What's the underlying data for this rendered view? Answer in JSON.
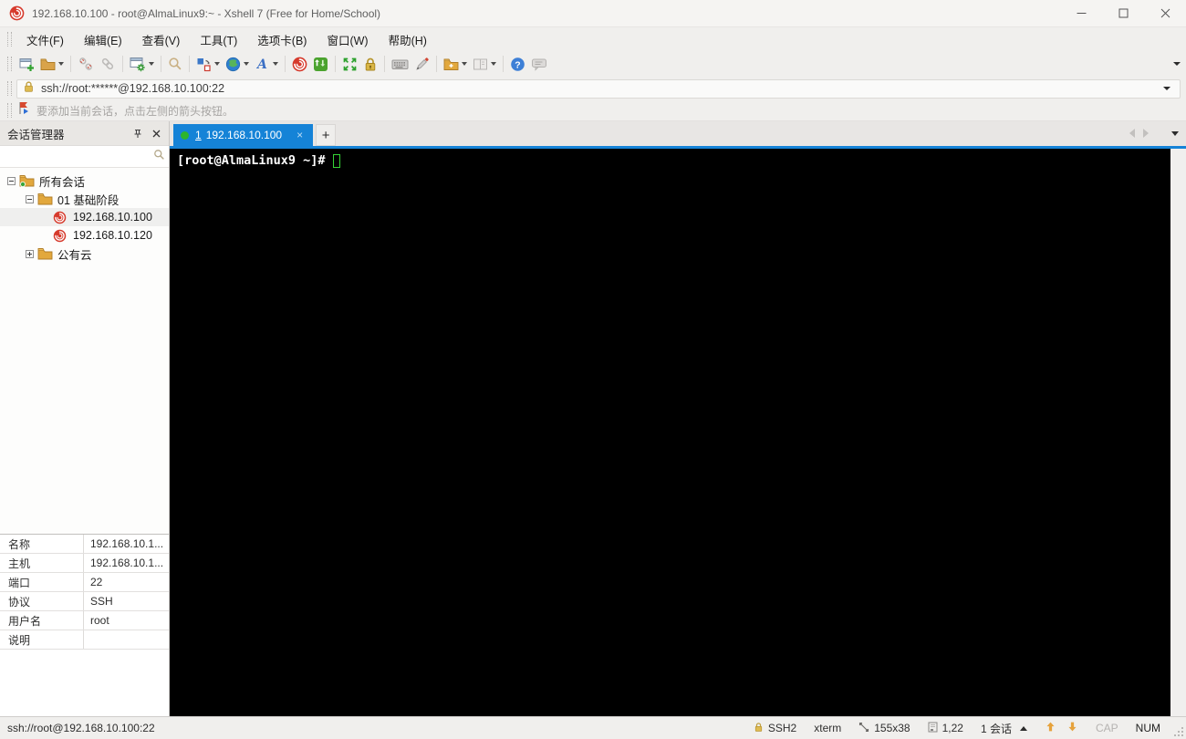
{
  "window": {
    "title": "192.168.10.100 - root@AlmaLinux9:~ - Xshell 7 (Free for Home/School)"
  },
  "menu": {
    "items": [
      "文件(F)",
      "编辑(E)",
      "查看(V)",
      "工具(T)",
      "选项卡(B)",
      "窗口(W)",
      "帮助(H)"
    ]
  },
  "toolbar": {
    "icon_names": [
      "new-session",
      "open-folder",
      "disconnect",
      "reconnect",
      "session-properties",
      "find",
      "compose-pane",
      "encoding-globe",
      "font",
      "xshell",
      "xftp",
      "fullscreen",
      "lock-screen",
      "virtual-keyboard",
      "highlight-pen",
      "new-folder",
      "tile-windows",
      "help",
      "feedback"
    ]
  },
  "address_bar": {
    "value": "ssh://root:******@192.168.10.100:22"
  },
  "info_bar": {
    "message": "要添加当前会话，点击左侧的箭头按钮。"
  },
  "session_manager": {
    "title": "会话管理器",
    "tree": [
      {
        "label": "所有会话",
        "level": 0,
        "icon": "folder-all-sessions",
        "expanded": true
      },
      {
        "label": "01 基础阶段",
        "level": 1,
        "icon": "folder",
        "expanded": true
      },
      {
        "label": "192.168.10.100",
        "level": 2,
        "icon": "xshell-session",
        "selected": true
      },
      {
        "label": "192.168.10.120",
        "level": 2,
        "icon": "xshell-session",
        "selected": false
      },
      {
        "label": "公有云",
        "level": 1,
        "icon": "folder",
        "expanded": false
      }
    ]
  },
  "properties_panel": {
    "rows": [
      {
        "label": "名称",
        "value": "192.168.10.1..."
      },
      {
        "label": "主机",
        "value": "192.168.10.1..."
      },
      {
        "label": "端口",
        "value": "22"
      },
      {
        "label": "协议",
        "value": "SSH"
      },
      {
        "label": "用户名",
        "value": "root"
      },
      {
        "label": "说明",
        "value": ""
      }
    ]
  },
  "tab_bar": {
    "active_tab": {
      "index": "1",
      "label": "192.168.10.100",
      "close_glyph": "×"
    },
    "new_tab_label": "+"
  },
  "terminal": {
    "prompt": "[root@AlmaLinux9 ~]#"
  },
  "status_bar": {
    "left": "ssh://root@192.168.10.100:22",
    "protocol": "SSH2",
    "terminal_type": "xterm",
    "size": "155x38",
    "cursor_position": "1,22",
    "session_count": "1 会话",
    "caps_indicator": "CAP",
    "num_indicator": "NUM"
  },
  "colors": {
    "tab_active": "#1583d7",
    "terminal_background": "#000000",
    "terminal_text": "#ffffff",
    "cursor_green": "#35d435",
    "xshell_red": "#d63a2c",
    "folder_yellow": "#e2a83d",
    "session_green_dot": "#2db52d"
  }
}
